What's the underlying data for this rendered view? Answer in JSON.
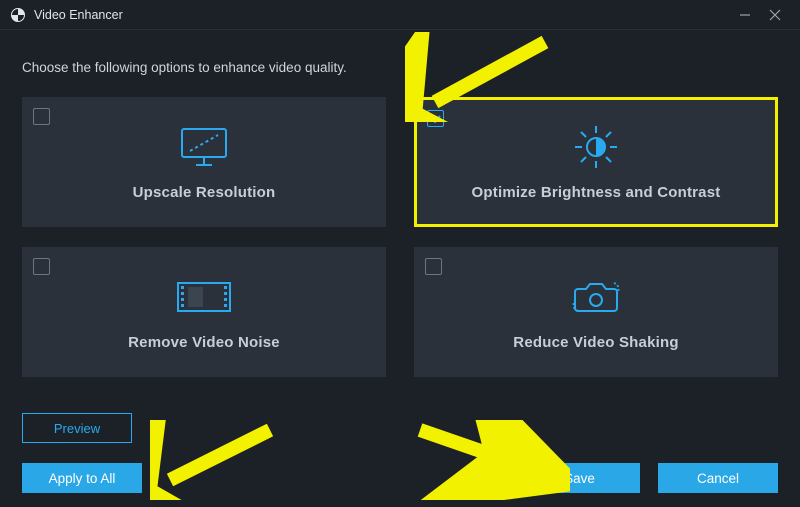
{
  "window": {
    "title": "Video Enhancer"
  },
  "instruction": "Choose the following options to enhance video quality.",
  "options": {
    "upscale": {
      "label": "Upscale Resolution",
      "checked": false
    },
    "brightness": {
      "label": "Optimize Brightness and Contrast",
      "checked": true
    },
    "noise": {
      "label": "Remove Video Noise",
      "checked": false
    },
    "shaking": {
      "label": "Reduce Video Shaking",
      "checked": false
    }
  },
  "buttons": {
    "preview": "Preview",
    "apply_all": "Apply to All",
    "save": "Save",
    "cancel": "Cancel"
  },
  "colors": {
    "accent": "#29aaf0",
    "highlight": "#f2f200",
    "bg": "#1b2127",
    "card": "#2a313a"
  }
}
